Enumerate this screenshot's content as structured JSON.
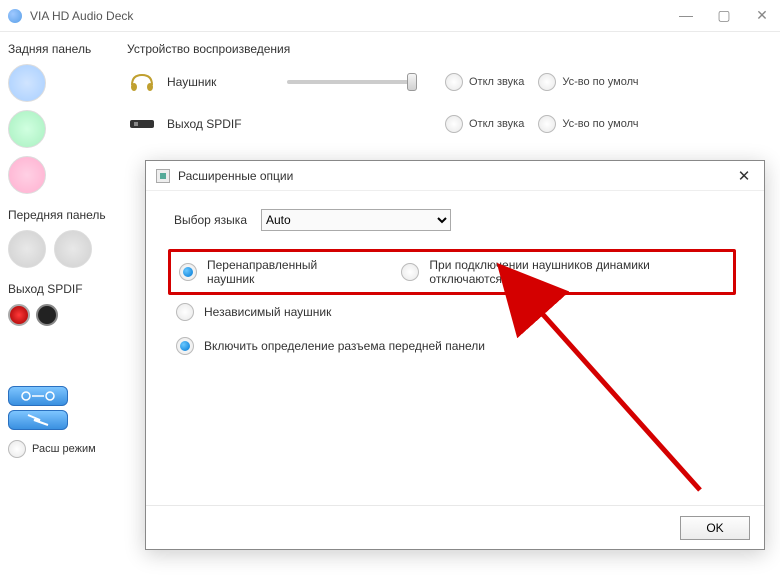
{
  "window": {
    "title": "VIA HD Audio Deck",
    "controls": {
      "min": "—",
      "max": "▢",
      "close": "✕"
    }
  },
  "sidebar": {
    "rear_label": "Задняя панель",
    "front_label": "Передняя панель",
    "spdif_label": "Выход SPDIF",
    "ext_mode_label": "Расш режим"
  },
  "main": {
    "devices_heading": "Устройство воспроизведения",
    "rows": [
      {
        "label": "Наушник"
      },
      {
        "label": "Выход SPDIF"
      }
    ],
    "opt_mute": "Откл звука",
    "opt_default": "Ус-во по умолч"
  },
  "dialog": {
    "title": "Расширенные опции",
    "close": "✕",
    "lang_label": "Выбор языка",
    "lang_value": "Auto",
    "opt_redirected": "Перенаправленный наушник",
    "opt_disable_speakers": "При подключении наушников динамики отключаются",
    "opt_independent": "Независимый наушник",
    "opt_front_jack_detect": "Включить определение разъема передней панели",
    "ok": "OK"
  }
}
